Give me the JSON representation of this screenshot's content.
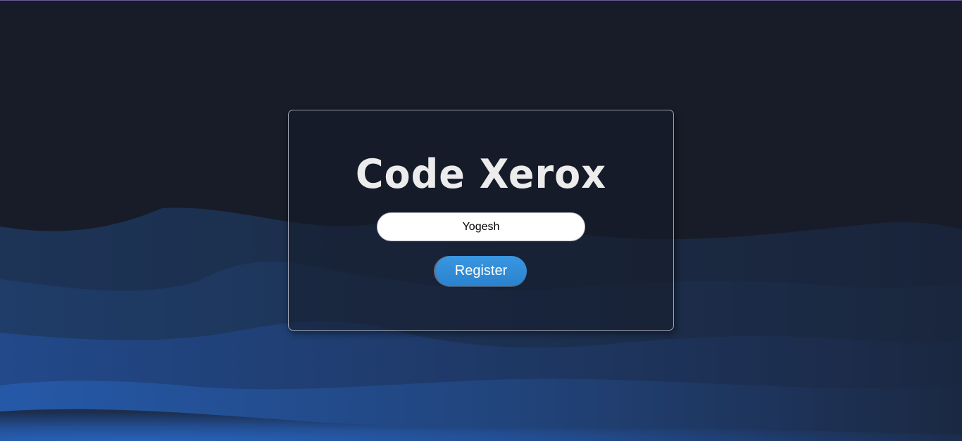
{
  "card": {
    "title": "Code Xerox"
  },
  "form": {
    "name_value": "Yogesh",
    "register_label": "Register"
  },
  "colors": {
    "background": "#171c28",
    "wave_blue": "#2563b8",
    "button": "#2e8ad6"
  }
}
